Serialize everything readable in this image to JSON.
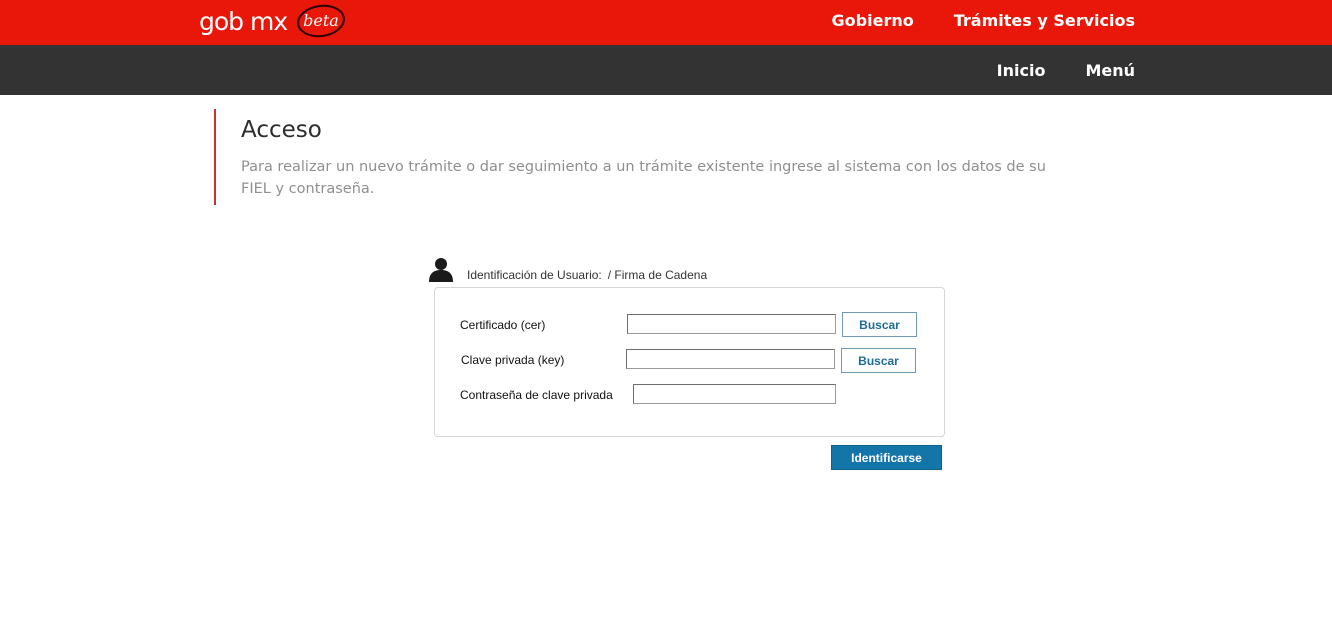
{
  "header": {
    "logo_text": "gob mx",
    "logo_badge": "beta",
    "nav": [
      "Gobierno",
      "Trámites y Servicios"
    ]
  },
  "subheader": {
    "nav": [
      "Inicio",
      "Menú"
    ]
  },
  "page": {
    "title": "Acceso",
    "description": "Para realizar un nuevo trámite o dar seguimiento a un trámite existente ingrese al sistema con los datos de su FIEL y contraseña."
  },
  "identification": {
    "label": "Identificación de Usuario:",
    "method": "/ Firma de Cadena"
  },
  "form": {
    "certificate_label": "Certificado (cer)",
    "certificate_value": "",
    "key_label": "Clave privada (key)",
    "key_value": "",
    "password_label": "Contraseña de clave privada",
    "password_value": "",
    "browse_label": "Buscar",
    "submit_label": "Identificarse"
  },
  "colors": {
    "top_bar": "#e8170a",
    "sub_bar": "#333333",
    "accent_line": "#c0392b",
    "primary_button": "#1475a8"
  }
}
